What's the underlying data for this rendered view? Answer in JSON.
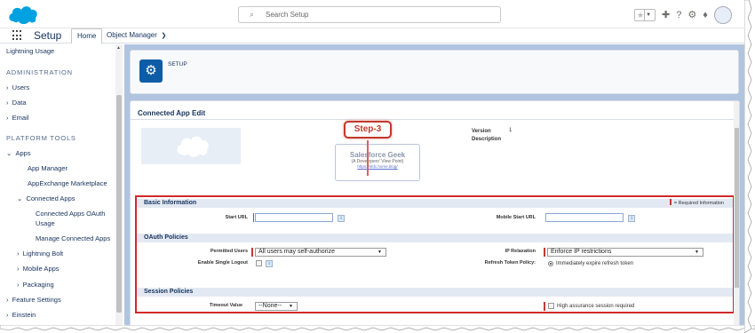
{
  "topbar": {
    "search_placeholder": "Search Setup",
    "icons": [
      "salesforce-cloud-logo",
      "search-icon",
      "favorites-star-icon",
      "add-icon",
      "help-icon",
      "gear-icon",
      "bell-icon",
      "avatar"
    ]
  },
  "navbar": {
    "app_name": "Setup",
    "tabs": [
      {
        "label": "Home"
      },
      {
        "label": "Object Manager"
      }
    ]
  },
  "sidebar": {
    "items": [
      {
        "label": "Lightning Usage"
      },
      {
        "label": "ADMINISTRATION"
      },
      {
        "label": "Users"
      },
      {
        "label": "Data"
      },
      {
        "label": "Email"
      },
      {
        "label": "PLATFORM TOOLS"
      },
      {
        "label": "Apps"
      },
      {
        "label": "App Manager"
      },
      {
        "label": "AppExchange Marketplace"
      },
      {
        "label": "Connected Apps"
      },
      {
        "label": "Connected Apps OAuth"
      },
      {
        "label": "Usage"
      },
      {
        "label": "Manage Connected Apps"
      },
      {
        "label": "Lightning Bolt"
      },
      {
        "label": "Mobile Apps"
      },
      {
        "label": "Packaging"
      },
      {
        "label": "Feature Settings"
      },
      {
        "label": "Einstein"
      }
    ]
  },
  "header": {
    "setup_label": "SETUP"
  },
  "page": {
    "title": "Connected App Edit",
    "version_label": "Version",
    "version_value": "1",
    "description_label": "Description"
  },
  "annotation": {
    "step": "Step-3",
    "watermark_title": "Salesforce Geek",
    "watermark_sub": "(A Developers' View Point)",
    "watermark_url": "https://sfdc.home.blog/"
  },
  "sections": {
    "basic": {
      "title": "Basic Information",
      "required_note": "= Required Information",
      "start_url_label": "Start URL",
      "mobile_start_url_label": "Mobile Start URL"
    },
    "oauth": {
      "title": "OAuth Policies",
      "permitted_users_label": "Permitted Users",
      "permitted_users_value": "All users may self-authorize",
      "ip_relaxation_label": "IP Relaxation",
      "ip_relaxation_value": "Enforce IP restrictions",
      "single_logout_label": "Enable Single Logout",
      "refresh_token_label": "Refresh Token Policy:",
      "refresh_token_value": "Immediately expire refresh token"
    },
    "session": {
      "title": "Session Policies",
      "timeout_label": "Timeout Value",
      "timeout_value": "--None--",
      "high_assurance_label": "High assurance session required"
    }
  },
  "colors": {
    "brand": "#00a1e0",
    "setup_icon": "#0d5da6",
    "highlight": "#d02a2a",
    "main_bg": "#b0c4df"
  }
}
